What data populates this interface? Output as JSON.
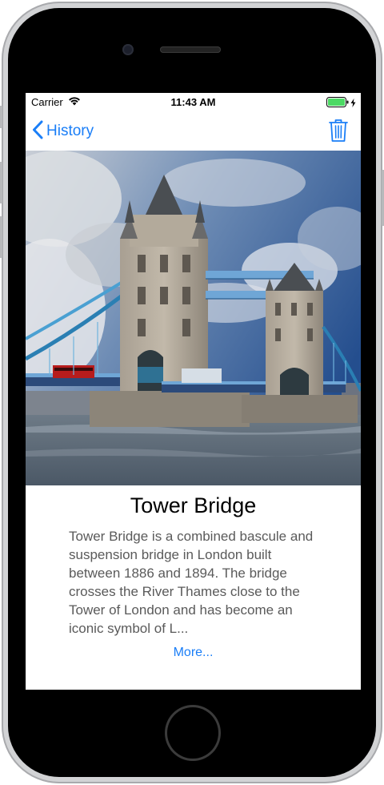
{
  "status_bar": {
    "carrier": "Carrier",
    "time": "11:43 AM",
    "battery_color": "#4cd964"
  },
  "nav": {
    "back_label": "History",
    "accent_color": "#1a7ef7",
    "back_icon": "chevron-left-icon",
    "trash_icon": "trash-icon"
  },
  "detail": {
    "title": "Tower Bridge",
    "description": "Tower Bridge is a combined bascule and suspension bridge in London built between 1886 and 1894. The bridge crosses the River Thames close to the Tower of London and has become an iconic symbol of L...",
    "more_label": "More..."
  }
}
